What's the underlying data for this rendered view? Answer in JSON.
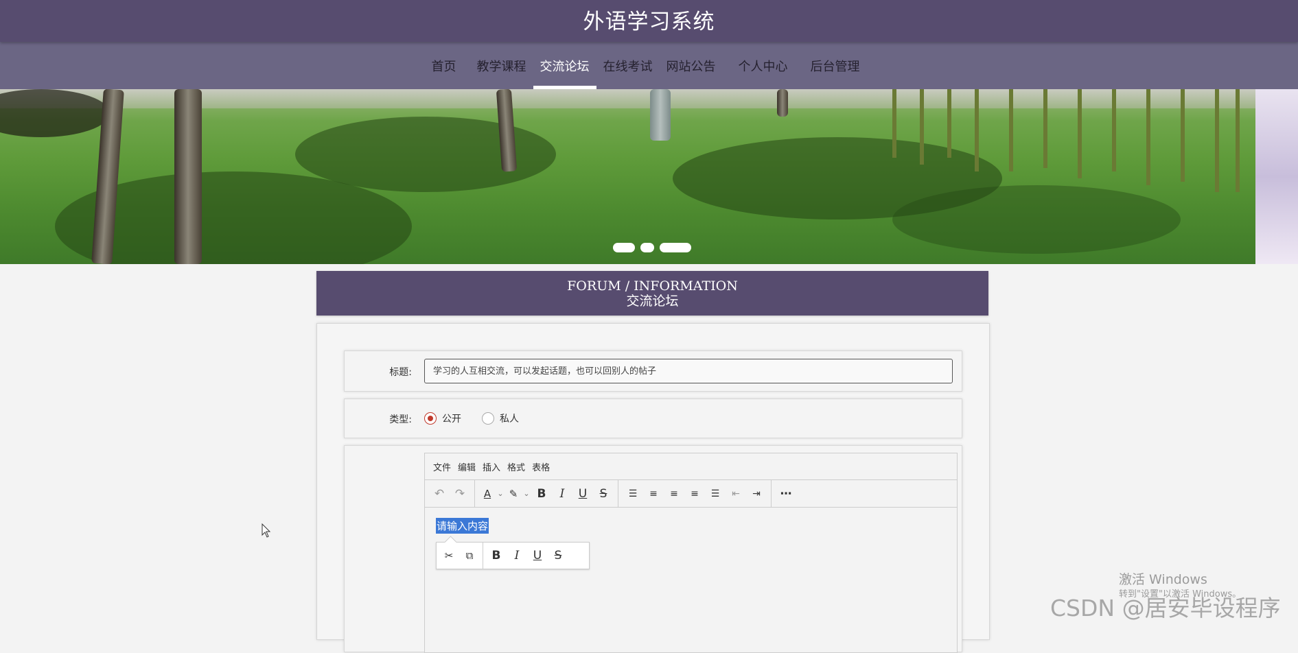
{
  "header": {
    "title": "外语学习系统"
  },
  "nav": {
    "items": [
      {
        "label": "首页",
        "active": false
      },
      {
        "label": "教学课程",
        "active": false
      },
      {
        "label": "交流论坛",
        "active": true
      },
      {
        "label": "在线考试",
        "active": false
      },
      {
        "label": "网站公告",
        "active": false
      },
      {
        "label": "个人中心",
        "active": false
      },
      {
        "label": "后台管理",
        "active": false
      }
    ]
  },
  "carousel": {
    "slide_count": 3
  },
  "section": {
    "title_en": "FORUM / INFORMATION",
    "title_cn": "交流论坛"
  },
  "form": {
    "title_label": "标题:",
    "title_value": "学习的人互相交流，可以发起话题，也可以回别人的帖子",
    "type_label": "类型:",
    "type_options": [
      {
        "label": "公开",
        "checked": true
      },
      {
        "label": "私人",
        "checked": false
      }
    ]
  },
  "editor": {
    "menus": [
      "文件",
      "编辑",
      "插入",
      "格式",
      "表格"
    ],
    "placeholder": "请输入内容"
  },
  "watermarks": {
    "windows_title": "激活 Windows",
    "windows_sub": "转到\"设置\"以激活 Windows。",
    "csdn": "CSDN @居安毕设程序"
  }
}
